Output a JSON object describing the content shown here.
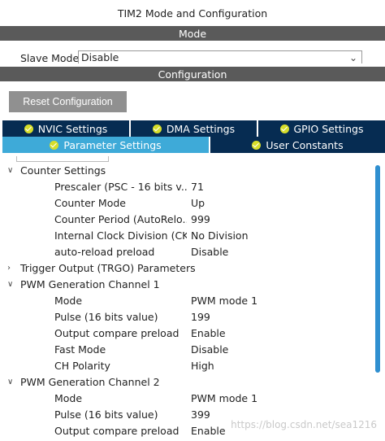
{
  "window": {
    "title": "TIM2 Mode and Configuration"
  },
  "mode_section": {
    "label": "Mode"
  },
  "slave_mode": {
    "label": "Slave Mode",
    "value": "Disable"
  },
  "config_section": {
    "label": "Configuration"
  },
  "reset_button": {
    "label": "Reset Configuration"
  },
  "tabs_row1": [
    {
      "label": "NVIC Settings"
    },
    {
      "label": "DMA Settings"
    },
    {
      "label": "GPIO Settings"
    }
  ],
  "tabs_row2": [
    {
      "label": "Parameter Settings",
      "active": true
    },
    {
      "label": "User Constants"
    }
  ],
  "groups": {
    "counter": {
      "label": "Counter Settings",
      "params": [
        {
          "name": "Prescaler (PSC - 16 bits v...",
          "value": "71"
        },
        {
          "name": "Counter Mode",
          "value": "Up"
        },
        {
          "name": "Counter Period (AutoRelo...",
          "value": "999"
        },
        {
          "name": "Internal Clock Division (CK...",
          "value": "No Division"
        },
        {
          "name": "auto-reload preload",
          "value": "Disable"
        }
      ]
    },
    "trgo": {
      "label": "Trigger Output (TRGO) Parameters"
    },
    "pwm1": {
      "label": "PWM Generation Channel 1",
      "params": [
        {
          "name": "Mode",
          "value": "PWM mode 1"
        },
        {
          "name": "Pulse (16 bits value)",
          "value": "199"
        },
        {
          "name": "Output compare preload",
          "value": "Enable"
        },
        {
          "name": "Fast Mode",
          "value": "Disable"
        },
        {
          "name": "CH Polarity",
          "value": "High"
        }
      ]
    },
    "pwm2": {
      "label": "PWM Generation Channel 2",
      "params": [
        {
          "name": "Mode",
          "value": "PWM mode 1"
        },
        {
          "name": "Pulse (16 bits value)",
          "value": "399"
        },
        {
          "name": "Output compare preload",
          "value": "Enable"
        }
      ]
    }
  },
  "watermark": "https://blog.csdn.net/sea1216",
  "colors": {
    "tab_dark": "#062c52",
    "tab_active": "#3eaad8",
    "check_icon": "#d7de2a",
    "section_bar": "#5a5a5a",
    "scrollbar": "#2f8fd0"
  }
}
